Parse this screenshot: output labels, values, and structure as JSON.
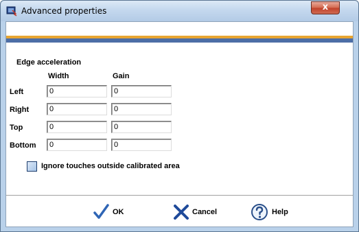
{
  "window": {
    "title": "Advanced properties",
    "close_label": "x"
  },
  "edge": {
    "section_title": "Edge acceleration",
    "col_width": "Width",
    "col_gain": "Gain",
    "rows": [
      {
        "label": "Left",
        "width": "0",
        "gain": "0"
      },
      {
        "label": "Right",
        "width": "0",
        "gain": "0"
      },
      {
        "label": "Top",
        "width": "0",
        "gain": "0"
      },
      {
        "label": "Bottom",
        "width": "0",
        "gain": "0"
      }
    ]
  },
  "ignore": {
    "label": "Ignore touches outside calibrated area",
    "checked": false
  },
  "buttons": {
    "ok": "OK",
    "cancel": "Cancel",
    "help": "Help"
  },
  "icons": {
    "app": "touch-device-icon",
    "ok": "checkmark-icon",
    "cancel": "x-mark-icon",
    "help": "question-icon"
  },
  "colors": {
    "title_gradient_top": "#dce9f6",
    "band_orange": "#e8a531",
    "band_blue": "#4d6ea6",
    "close_red": "#c1412a",
    "ok_blue": "#2f65b5",
    "cancel_blue": "#1f4a9a"
  }
}
